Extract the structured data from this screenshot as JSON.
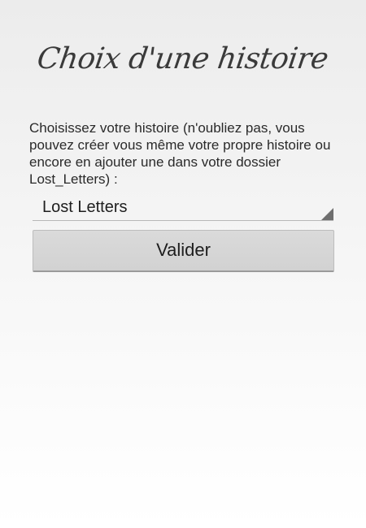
{
  "header": {
    "title": "Choix d'une histoire"
  },
  "instructions": "Choisissez votre histoire (n'oubliez pas, vous pouvez créer vous même votre propre histoire ou encore en ajouter une dans votre dossier Lost_Letters) :",
  "story_select": {
    "selected": "Lost Letters"
  },
  "buttons": {
    "validate_label": "Valider"
  }
}
